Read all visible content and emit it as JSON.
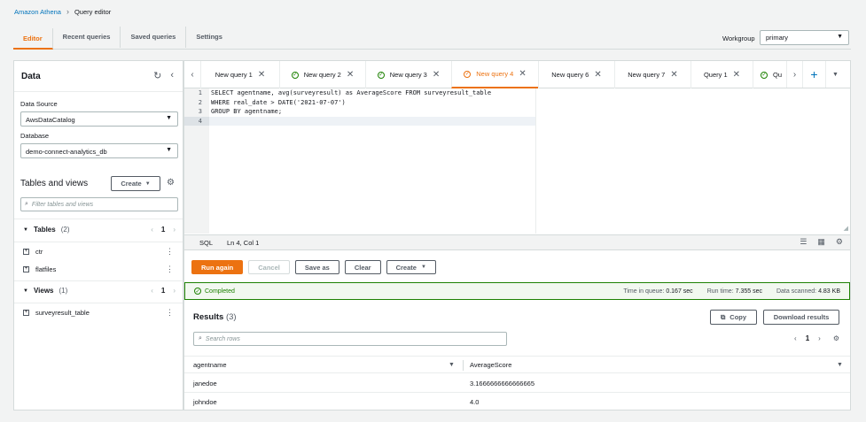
{
  "breadcrumb": {
    "root": "Amazon Athena",
    "current": "Query editor"
  },
  "top_tabs": [
    "Editor",
    "Recent queries",
    "Saved queries",
    "Settings"
  ],
  "workgroup": {
    "label": "Workgroup",
    "value": "primary"
  },
  "sidebar": {
    "title": "Data",
    "data_source_label": "Data Source",
    "data_source_value": "AwsDataCatalog",
    "database_label": "Database",
    "database_value": "demo-connect-analytics_db",
    "tables_views_title": "Tables and views",
    "create_label": "Create",
    "filter_placeholder": "Filter tables and views",
    "tables": {
      "label": "Tables",
      "count": "(2)",
      "page": "1",
      "items": [
        "ctr",
        "flatfiles"
      ]
    },
    "views": {
      "label": "Views",
      "count": "(1)",
      "page": "1",
      "items": [
        "surveyresult_table"
      ]
    }
  },
  "query_tabs": [
    {
      "label": "New query 1",
      "status": "none"
    },
    {
      "label": "New query 2",
      "status": "ok"
    },
    {
      "label": "New query 3",
      "status": "ok"
    },
    {
      "label": "New query 4",
      "status": "ok"
    },
    {
      "label": "New query 6",
      "status": "none"
    },
    {
      "label": "New query 7",
      "status": "none"
    },
    {
      "label": "Query 1",
      "status": "none"
    },
    {
      "label": "Qu",
      "status": "ok"
    }
  ],
  "editor": {
    "line_numbers": [
      "1",
      "2",
      "3",
      "4"
    ],
    "lines": [
      "SELECT agentname, avg(surveyresult) as AverageScore FROM surveyresult_table",
      "WHERE real_date > DATE('2021-07-07')",
      "GROUP BY agentname;",
      ""
    ]
  },
  "status_bar": {
    "language": "SQL",
    "position": "Ln 4, Col 1"
  },
  "actions": {
    "run": "Run again",
    "cancel": "Cancel",
    "save": "Save as",
    "clear": "Clear",
    "create": "Create"
  },
  "execution": {
    "status": "Completed",
    "queue_label": "Time in queue:",
    "queue_value": "0.167 sec",
    "run_label": "Run time:",
    "run_value": "7.355 sec",
    "scanned_label": "Data scanned:",
    "scanned_value": "4.83 KB"
  },
  "results": {
    "title": "Results",
    "count": "(3)",
    "copy_label": "Copy",
    "download_label": "Download results",
    "search_placeholder": "Search rows",
    "page": "1",
    "columns": [
      "agentname",
      "AverageScore"
    ],
    "rows": [
      [
        "janedoe",
        "3.1666666666666665"
      ],
      [
        "johndoe",
        "4.0"
      ]
    ]
  },
  "colors": {
    "accent": "#ec7211",
    "success": "#1d8102",
    "link": "#0073bb"
  }
}
